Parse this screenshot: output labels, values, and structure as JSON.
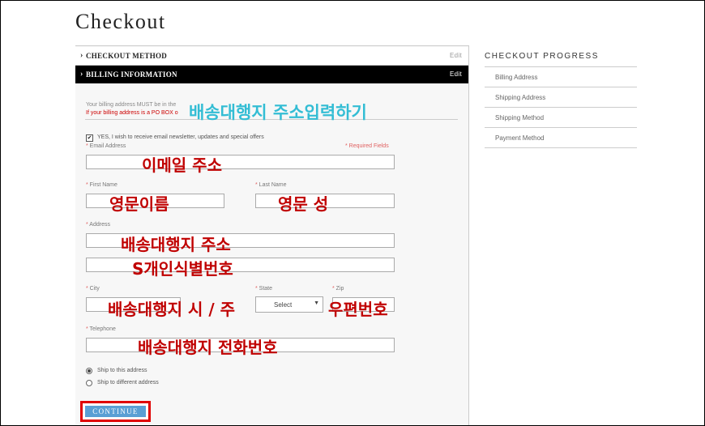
{
  "page": {
    "title": "Checkout"
  },
  "sections": {
    "checkout_method": {
      "label": "CHECKOUT METHOD",
      "edit": "Edit"
    },
    "billing_information": {
      "label": "BILLING INFORMATION",
      "edit": "Edit"
    }
  },
  "billing": {
    "note_line1": "Your billing address MUST be in the",
    "note_line2": "If your billing address is a PO BOX o",
    "newsletter": {
      "checked": true,
      "label": "YES, I wish to receive email newsletter, updates and special offers"
    },
    "required_note": "* Required Fields",
    "fields": {
      "email": {
        "label": "Email Address",
        "value": ""
      },
      "first_name": {
        "label": "First Name",
        "value": ""
      },
      "last_name": {
        "label": "Last Name",
        "value": ""
      },
      "address": {
        "label": "Address",
        "line1": "",
        "line2": ""
      },
      "city": {
        "label": "City",
        "value": ""
      },
      "state": {
        "label": "State",
        "selected": "Select"
      },
      "zip": {
        "label": "Zip",
        "value": ""
      },
      "telephone": {
        "label": "Telephone",
        "value": ""
      }
    },
    "shipping_options": [
      {
        "label": "Ship to this address",
        "selected": true
      },
      {
        "label": "Ship to different address",
        "selected": false
      }
    ],
    "continue_label": "CONTINUE"
  },
  "annotations": {
    "heading": "배송대행지 주소입력하기",
    "email": "이메일 주소",
    "first_name": "영문이름",
    "last_name": "영문 성",
    "address1": "배송대행지 주소",
    "address2": "S개인식별번호",
    "city_state": "배송대행지 시 / 주",
    "zip": "우편번호",
    "phone": "배송대행지 전화번호"
  },
  "sidebar": {
    "title": "CHECKOUT PROGRESS",
    "items": [
      "Billing Address",
      "Shipping Address",
      "Shipping Method",
      "Payment Method"
    ]
  },
  "colors": {
    "annotation_red": "#c00000",
    "annotation_cyan": "#33bdd4",
    "continue_button": "#5a9fd4",
    "highlight_border": "#e00000"
  }
}
